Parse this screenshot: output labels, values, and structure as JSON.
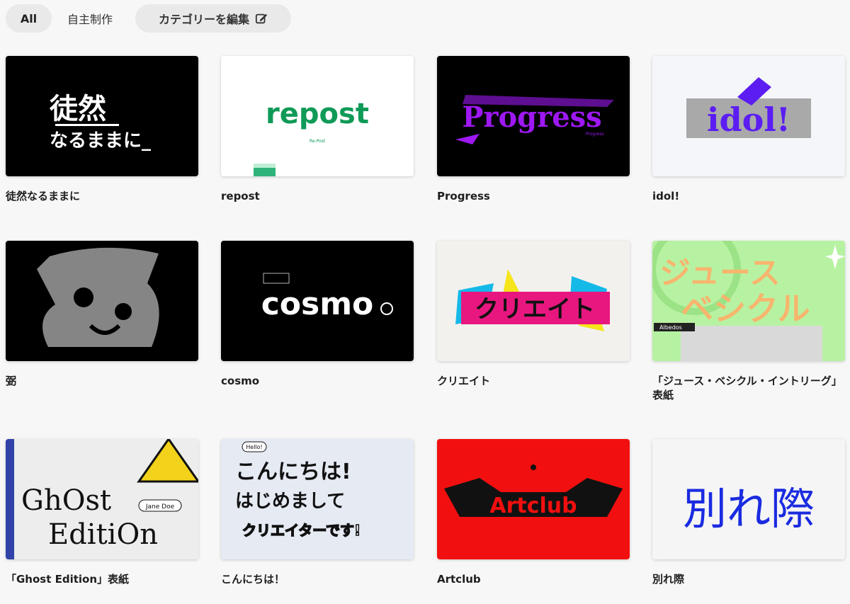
{
  "filters": {
    "all": "All",
    "own_work": "自主制作",
    "edit_categories": "カテゴリーを編集"
  },
  "works": [
    {
      "title": "徒然なるままに",
      "image": {
        "background": "#000000",
        "accent": "#ffffff",
        "lettering": "徒然 なるままに"
      }
    },
    {
      "title": "repost",
      "image": {
        "background": "#ffffff",
        "accent": "#0f9a57",
        "lettering": "repost",
        "small_text": "Re-Post"
      }
    },
    {
      "title": "Progress",
      "image": {
        "background": "#000000",
        "accent": "#9d18f2",
        "lettering": "Progress",
        "small_text": "Progress"
      }
    },
    {
      "title": "idol!",
      "image": {
        "background": "#f4f6fa",
        "accent": "#5b1df2",
        "lettering": "idol!"
      }
    },
    {
      "title": "弼",
      "image": {
        "background": "#000000",
        "accent": "#858585",
        "lettering": "弼"
      }
    },
    {
      "title": "cosmo",
      "image": {
        "background": "#000000",
        "accent": "#ffffff",
        "lettering": "cosmo"
      }
    },
    {
      "title": "クリエイト",
      "image": {
        "background": "#f2f1ee",
        "accent": "#e8177f",
        "lettering": "クリエイト"
      }
    },
    {
      "title": "「ジュース・ベシクル・イントリーグ」表紙",
      "image": {
        "background": "#b7f2a2",
        "accent": "#f7b56e",
        "lettering": "ジュース ベシクル",
        "small_text": "Albedos"
      }
    },
    {
      "title": "「Ghost Edition」表紙",
      "image": {
        "background": "#ededed",
        "accent": "#f2d21a",
        "lettering": "GhOst EditiOn",
        "small_text": "Jane Doe"
      }
    },
    {
      "title": "こんにちは！",
      "image": {
        "background": "#e6eaf3",
        "accent": "#111111",
        "lettering": "こんにちは! はじめまして クリエイターです!",
        "small_text": "Hello!"
      }
    },
    {
      "title": "Artclub",
      "image": {
        "background": "#f20f0f",
        "accent": "#111111",
        "lettering": "Artclub"
      }
    },
    {
      "title": "別れ際",
      "image": {
        "background": "#f5f5f5",
        "accent": "#1a2be0",
        "lettering": "別れ際"
      }
    }
  ]
}
